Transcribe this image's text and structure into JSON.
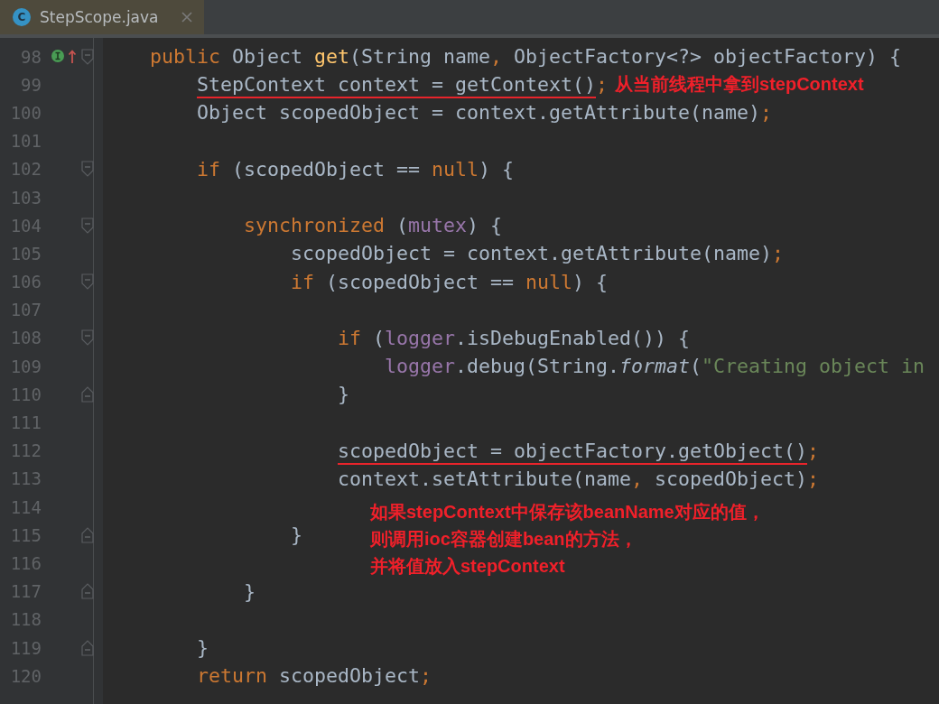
{
  "tab": {
    "icon_letter": "C",
    "title": "StepScope.java",
    "selected": true
  },
  "lines": [
    {
      "number": "98",
      "implements_marker": true,
      "override_marker": true,
      "fold_start": true,
      "tokens": [
        {
          "kind": "kw",
          "text": "public"
        },
        {
          "kind": "plain",
          "text": " Object "
        },
        {
          "kind": "decl",
          "text": "get"
        },
        {
          "kind": "plain",
          "text": "(String name"
        },
        {
          "kind": "punct",
          "text": ","
        },
        {
          "kind": "plain",
          "text": " ObjectFactory<?> objectFactory) {"
        }
      ]
    },
    {
      "number": "99",
      "tokens": [
        {
          "kind": "plain",
          "text": "StepContext context = getContext()",
          "underlined": true
        },
        {
          "kind": "punct",
          "text": ";"
        }
      ],
      "note": "从当前线程中拿到stepContext"
    },
    {
      "number": "100",
      "tokens": [
        {
          "kind": "plain",
          "text": "Object scopedObject = context.getAttribute(name)"
        },
        {
          "kind": "punct",
          "text": ";"
        }
      ]
    },
    {
      "number": "101"
    },
    {
      "number": "102",
      "fold_start": true,
      "tokens": [
        {
          "kind": "kw",
          "text": "if"
        },
        {
          "kind": "plain",
          "text": " (scopedObject == "
        },
        {
          "kind": "kw",
          "text": "null"
        },
        {
          "kind": "plain",
          "text": ") {"
        }
      ]
    },
    {
      "number": "103"
    },
    {
      "number": "104",
      "fold_start": true,
      "tokens": [
        {
          "kind": "kw",
          "text": "synchronized"
        },
        {
          "kind": "plain",
          "text": " ("
        },
        {
          "kind": "field",
          "text": "mutex"
        },
        {
          "kind": "plain",
          "text": ") {"
        }
      ]
    },
    {
      "number": "105",
      "tokens": [
        {
          "kind": "plain",
          "text": "scopedObject = context.getAttribute(name)"
        },
        {
          "kind": "punct",
          "text": ";"
        }
      ]
    },
    {
      "number": "106",
      "fold_start": true,
      "tokens": [
        {
          "kind": "kw",
          "text": "if"
        },
        {
          "kind": "plain",
          "text": " (scopedObject == "
        },
        {
          "kind": "kw",
          "text": "null"
        },
        {
          "kind": "plain",
          "text": ") {"
        }
      ]
    },
    {
      "number": "107"
    },
    {
      "number": "108",
      "fold_start": true,
      "tokens": [
        {
          "kind": "kw",
          "text": "if"
        },
        {
          "kind": "plain",
          "text": " ("
        },
        {
          "kind": "field",
          "text": "logger"
        },
        {
          "kind": "plain",
          "text": ".isDebugEnabled()) {"
        }
      ]
    },
    {
      "number": "109",
      "tokens": [
        {
          "kind": "field",
          "text": "logger"
        },
        {
          "kind": "plain",
          "text": ".debug(String."
        },
        {
          "kind": "static",
          "text": "format"
        },
        {
          "kind": "plain",
          "text": "("
        },
        {
          "kind": "str",
          "text": "\"Creating object in"
        }
      ]
    },
    {
      "number": "110",
      "fold_end": true,
      "tokens": [
        {
          "kind": "plain",
          "text": "}"
        }
      ]
    },
    {
      "number": "111"
    },
    {
      "number": "112",
      "tokens": [
        {
          "kind": "plain",
          "text": "scopedObject = objectFactory.getObject()",
          "underlined": true
        },
        {
          "kind": "punct",
          "text": ";"
        }
      ]
    },
    {
      "number": "113",
      "tokens": [
        {
          "kind": "plain",
          "text": "context.setAttribute(name"
        },
        {
          "kind": "punct",
          "text": ","
        },
        {
          "kind": "plain",
          "text": " scopedObject)"
        },
        {
          "kind": "punct",
          "text": ";"
        }
      ]
    },
    {
      "number": "114",
      "callout": [
        "如果stepContext中保存该beanName对应的值，",
        "则调用ioc容器创建bean的方法，",
        "并将值放入stepContext"
      ]
    },
    {
      "number": "115",
      "fold_end": true,
      "tokens": [
        {
          "kind": "plain",
          "text": "}"
        }
      ]
    },
    {
      "number": "116"
    },
    {
      "number": "117",
      "fold_end": true,
      "tokens": [
        {
          "kind": "plain",
          "text": "}"
        }
      ]
    },
    {
      "number": "118"
    },
    {
      "number": "119",
      "fold_end": true,
      "tokens": [
        {
          "kind": "plain",
          "text": "}"
        }
      ]
    },
    {
      "number": "120",
      "tokens": [
        {
          "kind": "kw",
          "text": "return"
        },
        {
          "kind": "plain",
          "text": " scopedObject"
        },
        {
          "kind": "punct",
          "text": ";"
        }
      ]
    }
  ]
}
